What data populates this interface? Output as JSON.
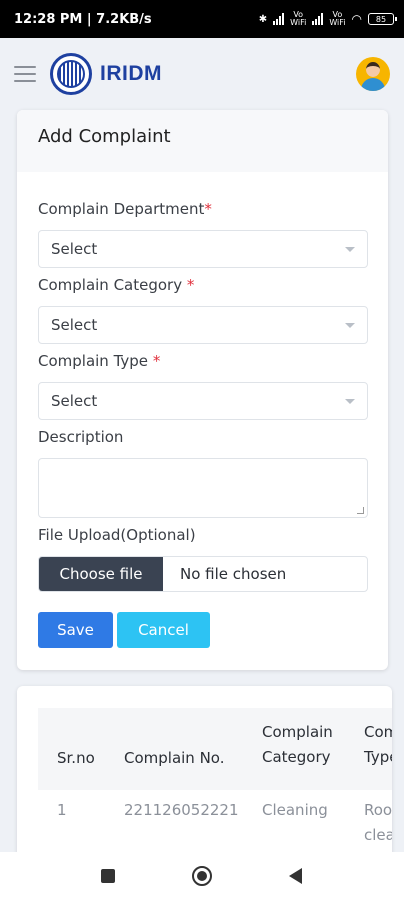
{
  "status_bar": {
    "time_speed": "12:28 PM | 7.2KB/s",
    "lte_1": "Vo\nWiFi",
    "lte_2": "Vo\nWiFi",
    "battery": "85"
  },
  "app_bar": {
    "brand": "IRIDM"
  },
  "form": {
    "title": "Add Complaint",
    "department_label": "Complain Department",
    "department_value": "Select",
    "category_label": "Complain Category ",
    "category_value": "Select",
    "type_label": "Complain Type ",
    "type_value": "Select",
    "required_mark": "*",
    "description_label": "Description",
    "file_label": "File Upload(Optional)",
    "choose_file": "Choose file",
    "no_file": "No file chosen",
    "save": "Save",
    "cancel": "Cancel"
  },
  "table": {
    "headers": [
      "Sr.no",
      "Complain No.",
      "Complain\nCategory",
      "Comp\nType"
    ],
    "rows": [
      [
        "1",
        "221126052221",
        "Cleaning",
        "Room\nclean"
      ]
    ]
  }
}
